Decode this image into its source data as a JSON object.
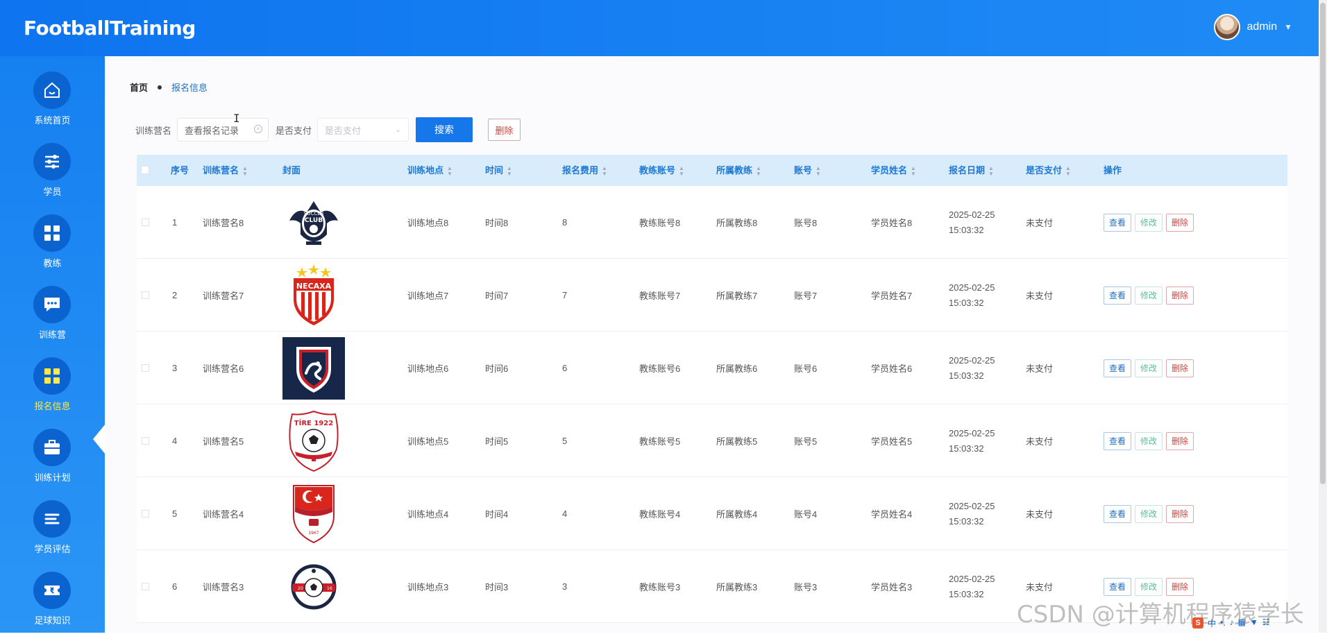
{
  "app": {
    "title": "FootballTraining"
  },
  "user": {
    "name": "admin"
  },
  "sidebar": {
    "items": [
      {
        "label": "系统首页",
        "icon": "home-icon"
      },
      {
        "label": "学员",
        "icon": "sliders-icon"
      },
      {
        "label": "教练",
        "icon": "grid-icon"
      },
      {
        "label": "训练营",
        "icon": "chat-icon"
      },
      {
        "label": "报名信息",
        "icon": "grid-icon",
        "active": true
      },
      {
        "label": "训练计划",
        "icon": "briefcase-icon"
      },
      {
        "label": "学员评估",
        "icon": "list-icon"
      },
      {
        "label": "足球知识",
        "icon": "ticket-icon"
      }
    ]
  },
  "breadcrumb": {
    "home": "首页",
    "current": "报名信息"
  },
  "search": {
    "camp_label": "训练营名",
    "camp_value": "查看报名记录",
    "paid_label": "是否支付",
    "paid_placeholder": "是否支付",
    "search_button": "搜索",
    "delete_button": "删除"
  },
  "table": {
    "headers": [
      "序号",
      "训练营名",
      "封面",
      "训练地点",
      "时间",
      "报名费用",
      "教练账号",
      "所属教练",
      "账号",
      "学员姓名",
      "报名日期",
      "是否支付",
      "操作"
    ],
    "actions": {
      "view": "查看",
      "edit": "修改",
      "delete": "删除"
    },
    "rows": [
      {
        "idx": "1",
        "camp": "训练营名8",
        "cover": "soccer-club-logo",
        "place": "训练地点8",
        "time": "时间8",
        "fee": "8",
        "coach_acct": "教练账号8",
        "coach": "所属教练8",
        "acct": "账号8",
        "student": "学员姓名8",
        "date": "2025-02-25 15:03:32",
        "paid": "未支付"
      },
      {
        "idx": "2",
        "camp": "训练营名7",
        "cover": "necaxa-logo",
        "place": "训练地点7",
        "time": "时间7",
        "fee": "7",
        "coach_acct": "教练账号7",
        "coach": "所属教练7",
        "acct": "账号7",
        "student": "学员姓名7",
        "date": "2025-02-25 15:03:32",
        "paid": "未支付"
      },
      {
        "idx": "3",
        "camp": "训练营名6",
        "cover": "dragon-crest-logo",
        "place": "训练地点6",
        "time": "时间6",
        "fee": "6",
        "coach_acct": "教练账号6",
        "coach": "所属教练6",
        "acct": "账号6",
        "student": "学员姓名6",
        "date": "2025-02-25 15:03:32",
        "paid": "未支付"
      },
      {
        "idx": "4",
        "camp": "训练营名5",
        "cover": "tire-1922-logo",
        "place": "训练地点5",
        "time": "时间5",
        "fee": "5",
        "coach_acct": "教练账号5",
        "coach": "所属教练5",
        "acct": "账号5",
        "student": "学员姓名5",
        "date": "2025-02-25 15:03:32",
        "paid": "未支付"
      },
      {
        "idx": "5",
        "camp": "训练营名4",
        "cover": "elazigspor-logo",
        "place": "训练地点4",
        "time": "时间4",
        "fee": "4",
        "coach_acct": "教练账号4",
        "coach": "所属教练4",
        "acct": "账号4",
        "student": "学员姓名4",
        "date": "2025-02-25 15:03:32",
        "paid": "未支付"
      },
      {
        "idx": "6",
        "camp": "训练营名3",
        "cover": "round-ball-logo",
        "place": "训练地点3",
        "time": "时间3",
        "fee": "3",
        "coach_acct": "教练账号3",
        "coach": "所属教练3",
        "acct": "账号3",
        "student": "学员姓名3",
        "date": "2025-02-25 15:03:32",
        "paid": "未支付"
      }
    ]
  },
  "watermark": "CSDN @计算机程序猿学长",
  "colors": {
    "header": "#0e74ef",
    "sidebar": "#1580f0",
    "active": "#ffe84a",
    "primary": "#1677ea",
    "danger": "#d6403a",
    "success": "#5cbd97"
  }
}
